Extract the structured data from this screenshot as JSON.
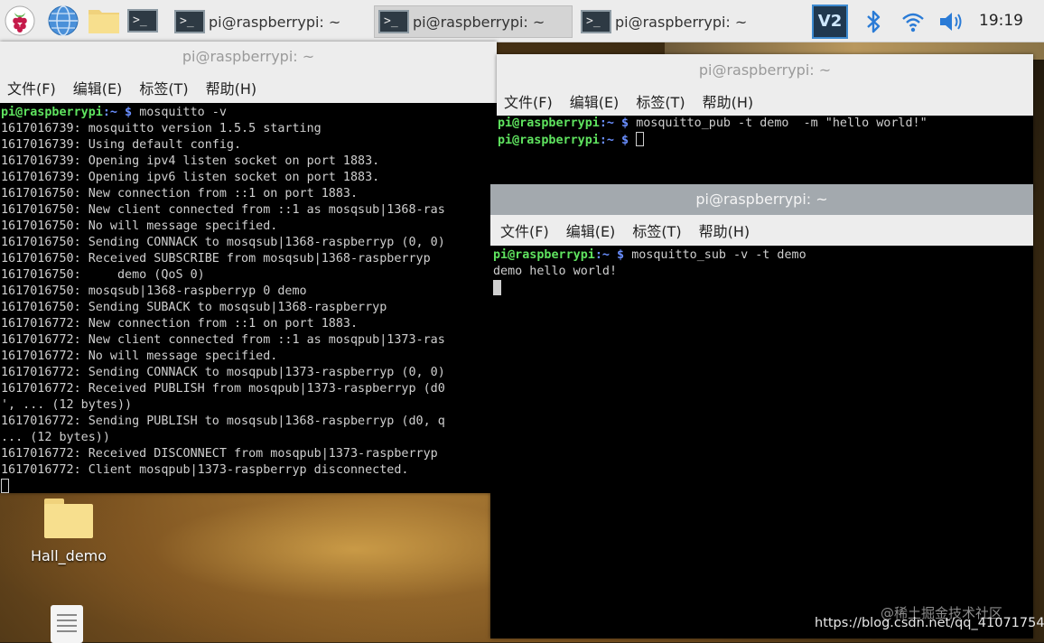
{
  "taskbar": {
    "tasks": [
      {
        "label": "pi@raspberrypi: ~"
      },
      {
        "label": "pi@raspberrypi: ~"
      },
      {
        "label": "pi@raspberrypi: ~"
      }
    ],
    "clock": "19:19",
    "vnc_label": "V2",
    "term_glyph": ">_"
  },
  "menu": {
    "file": "文件(F)",
    "edit": "编辑(E)",
    "tabs": "标签(T)",
    "help": "帮助(H)"
  },
  "prompt": {
    "user": "pi@raspberrypi",
    "path": ":~ $"
  },
  "windows": {
    "broker": {
      "title": "pi@raspberrypi: ~",
      "command": "mosquitto -v",
      "lines": [
        "1617016739: mosquitto version 1.5.5 starting",
        "1617016739: Using default config.",
        "1617016739: Opening ipv4 listen socket on port 1883.",
        "1617016739: Opening ipv6 listen socket on port 1883.",
        "1617016750: New connection from ::1 on port 1883.",
        "1617016750: New client connected from ::1 as mosqsub|1368-ras",
        "1617016750: No will message specified.",
        "1617016750: Sending CONNACK to mosqsub|1368-raspberryp (0, 0)",
        "1617016750: Received SUBSCRIBE from mosqsub|1368-raspberryp",
        "1617016750:     demo (QoS 0)",
        "1617016750: mosqsub|1368-raspberryp 0 demo",
        "1617016750: Sending SUBACK to mosqsub|1368-raspberryp",
        "1617016772: New connection from ::1 on port 1883.",
        "1617016772: New client connected from ::1 as mosqpub|1373-ras",
        "1617016772: No will message specified.",
        "1617016772: Sending CONNACK to mosqpub|1373-raspberryp (0, 0)",
        "1617016772: Received PUBLISH from mosqpub|1373-raspberryp (d0",
        "', ... (12 bytes))",
        "1617016772: Sending PUBLISH to mosqsub|1368-raspberryp (d0, q",
        "... (12 bytes))",
        "1617016772: Received DISCONNECT from mosqpub|1373-raspberryp",
        "1617016772: Client mosqpub|1373-raspberryp disconnected."
      ]
    },
    "publisher": {
      "title": "pi@raspberrypi: ~",
      "command": "mosquitto_pub -t demo  -m \"hello world!\""
    },
    "subscriber": {
      "title": "pi@raspberrypi: ~",
      "command": "mosquitto_sub -v -t demo",
      "output": "demo hello world!"
    }
  },
  "desktop": {
    "icons": [
      {
        "label": "Hall_demo"
      }
    ]
  },
  "watermark": "@稀土掘金技术社区",
  "url": "https://blog.csdn.net/qq_41071754",
  "icons": {
    "raspberry": "raspberry-pi-menu-icon",
    "browser": "globe-icon",
    "files": "folder-icon",
    "terminal": "terminal-icon",
    "bluetooth": "bluetooth-icon",
    "wifi": "wifi-icon",
    "volume": "volume-icon"
  }
}
